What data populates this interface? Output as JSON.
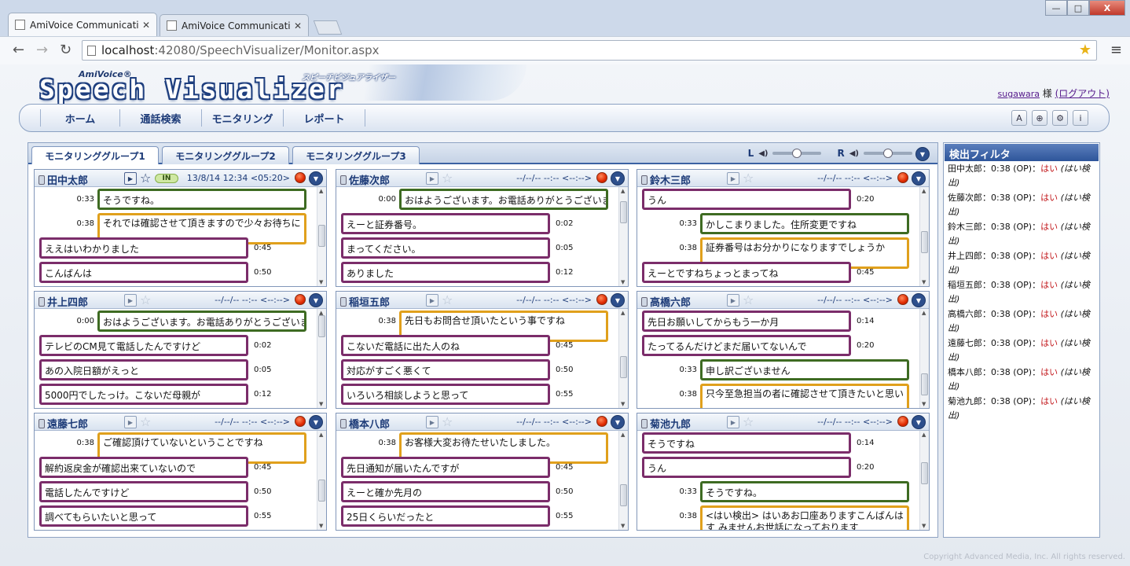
{
  "browser": {
    "tabs": [
      {
        "title": "AmiVoice Communicatio",
        "active": true
      },
      {
        "title": "AmiVoice Communicatio",
        "active": false
      }
    ],
    "url_host": "localhost",
    "url_rest": ":42080/SpeechVisualizer/Monitor.aspx",
    "window_buttons": [
      "—",
      "□",
      "X"
    ]
  },
  "header": {
    "logo_brand": "AmiVoice®",
    "logo_title": "Speech Visualizer",
    "logo_kana": "スピーチビジュアライザー",
    "user_name": "sugawara",
    "user_suffix": " 様 ",
    "logout": "(ログアウト)"
  },
  "nav": {
    "items": [
      "ホーム",
      "通話検索",
      "モニタリング",
      "レポート"
    ],
    "tools": [
      "A",
      "+",
      "gear",
      "i"
    ]
  },
  "monitor": {
    "tabs": [
      "モニタリンググループ1",
      "モニタリンググループ2",
      "モニタリンググループ3"
    ],
    "active_tab": 0,
    "volume_left_label": "L",
    "volume_right_label": "R",
    "volume_left_level": 0.5,
    "volume_right_level": 0.5
  },
  "panels": [
    {
      "name": "田中太郎",
      "active": true,
      "status": "IN",
      "time": "13/8/14 12:34 <05:20>",
      "utterances": [
        {
          "side": "op",
          "time": "0:33",
          "text": "そうですね。"
        },
        {
          "side": "op2",
          "time": "0:38",
          "text": "それでは確認させて頂きますので少々お待ちに"
        },
        {
          "side": "cust",
          "time": "0:45",
          "text": "ええはいわかりました"
        },
        {
          "side": "cust",
          "time": "0:50",
          "text": "こんばんは"
        }
      ]
    },
    {
      "name": "佐藤次郎",
      "active": false,
      "time": "--/--/-- --:-- <--:-->",
      "utterances": [
        {
          "side": "op",
          "time": "0:00",
          "text": "おはようございます。お電話ありがとうございます。"
        },
        {
          "side": "cust",
          "time": "0:02",
          "text": "えーと証券番号。"
        },
        {
          "side": "cust",
          "time": "0:05",
          "text": "まってください。"
        },
        {
          "side": "cust",
          "time": "0:12",
          "text": "ありました"
        }
      ]
    },
    {
      "name": "鈴木三郎",
      "active": false,
      "time": "--/--/-- --:-- <--:-->",
      "utterances": [
        {
          "side": "cust",
          "time": "0:20",
          "text": "うん"
        },
        {
          "side": "op",
          "time": "0:33",
          "text": "かしこまりました。住所変更ですね"
        },
        {
          "side": "op2",
          "time": "0:38",
          "text": "証券番号はお分かりになりますでしょうか"
        },
        {
          "side": "cust",
          "time": "0:45",
          "text": "えーとですねちょっとまってね"
        }
      ]
    },
    {
      "name": "井上四郎",
      "active": false,
      "time": "--/--/-- --:-- <--:-->",
      "utterances": [
        {
          "side": "op",
          "time": "0:00",
          "text": "おはようございます。お電話ありがとうございます。"
        },
        {
          "side": "cust",
          "time": "0:02",
          "text": "テレビのCM見て電話したんですけど"
        },
        {
          "side": "cust",
          "time": "0:05",
          "text": "あの入院日額がえっと"
        },
        {
          "side": "cust",
          "time": "0:12",
          "text": "5000円でしたっけ。こないだ母親が"
        }
      ]
    },
    {
      "name": "稲垣五郎",
      "active": false,
      "time": "--/--/-- --:-- <--:-->",
      "utterances": [
        {
          "side": "op2",
          "time": "0:38",
          "text": "先日もお問合せ頂いたという事ですね"
        },
        {
          "side": "cust",
          "time": "0:45",
          "text": "こないだ電話に出た人のね"
        },
        {
          "side": "cust",
          "time": "0:50",
          "text": "対応がすごく悪くて"
        },
        {
          "side": "cust",
          "time": "0:55",
          "text": "いろいろ相談しようと思って"
        }
      ]
    },
    {
      "name": "高橋六郎",
      "active": false,
      "time": "--/--/-- --:-- <--:-->",
      "utterances": [
        {
          "side": "cust",
          "time": "0:14",
          "text": "先日お願いしてからもう一か月"
        },
        {
          "side": "cust",
          "time": "0:20",
          "text": "たってるんだけどまだ届いてないんで"
        },
        {
          "side": "op",
          "time": "0:33",
          "text": "申し訳ございません"
        },
        {
          "side": "op2",
          "time": "0:38",
          "text": "只今至急担当の者に確認させて頂きたいと思い"
        }
      ]
    },
    {
      "name": "遠藤七郎",
      "active": false,
      "time": "--/--/-- --:-- <--:-->",
      "utterances": [
        {
          "side": "op2",
          "time": "0:38",
          "text": "ご確認頂けていないということですね"
        },
        {
          "side": "cust",
          "time": "0:45",
          "text": "解約返戻金が確認出来ていないので"
        },
        {
          "side": "cust",
          "time": "0:50",
          "text": "電話したんですけど"
        },
        {
          "side": "cust",
          "time": "0:55",
          "text": "調べてもらいたいと思って"
        }
      ]
    },
    {
      "name": "橋本八郎",
      "active": false,
      "time": "--/--/-- --:-- <--:-->",
      "utterances": [
        {
          "side": "op2",
          "time": "0:38",
          "text": "お客様大変お待たせいたしました。"
        },
        {
          "side": "cust",
          "time": "0:45",
          "text": "先日通知が届いたんですが"
        },
        {
          "side": "cust",
          "time": "0:50",
          "text": "えーと確か先月の"
        },
        {
          "side": "cust",
          "time": "0:55",
          "text": "25日くらいだったと"
        }
      ]
    },
    {
      "name": "菊池九郎",
      "active": false,
      "time": "--/--/-- --:-- <--:-->",
      "utterances": [
        {
          "side": "cust",
          "time": "0:14",
          "text": "そうですね"
        },
        {
          "side": "cust",
          "time": "0:20",
          "text": "うん"
        },
        {
          "side": "op",
          "time": "0:33",
          "text": "そうですね。"
        },
        {
          "side": "op2",
          "time": "0:38",
          "text": "<はい検出> はいあお口座ありますこんばんはす みませんお世話になっております"
        }
      ]
    }
  ],
  "filter": {
    "title": "検出フィルタ",
    "entries": [
      {
        "name": "田中太郎",
        "time": "0:38",
        "role": "(OP)",
        "value": "はい",
        "note": "(はい検出)"
      },
      {
        "name": "佐藤次郎",
        "time": "0:38",
        "role": "(OP)",
        "value": "はい",
        "note": "(はい検出)"
      },
      {
        "name": "鈴木三郎",
        "time": "0:38",
        "role": "(OP)",
        "value": "はい",
        "note": "(はい検出)"
      },
      {
        "name": "井上四郎",
        "time": "0:38",
        "role": "(OP)",
        "value": "はい",
        "note": "(はい検出)"
      },
      {
        "name": "稲垣五郎",
        "time": "0:38",
        "role": "(OP)",
        "value": "はい",
        "note": "(はい検出)"
      },
      {
        "name": "高橋六郎",
        "time": "0:38",
        "role": "(OP)",
        "value": "はい",
        "note": "(はい検出)"
      },
      {
        "name": "遠藤七郎",
        "time": "0:38",
        "role": "(OP)",
        "value": "はい",
        "note": "(はい検出)"
      },
      {
        "name": "橋本八郎",
        "time": "0:38",
        "role": "(OP)",
        "value": "はい",
        "note": "(はい検出)"
      },
      {
        "name": "菊池九郎",
        "time": "0:38",
        "role": "(OP)",
        "value": "はい",
        "note": "(はい検出)"
      }
    ]
  },
  "footer": {
    "copyright": "Copyright Advanced Media, Inc. All rights reserved."
  }
}
